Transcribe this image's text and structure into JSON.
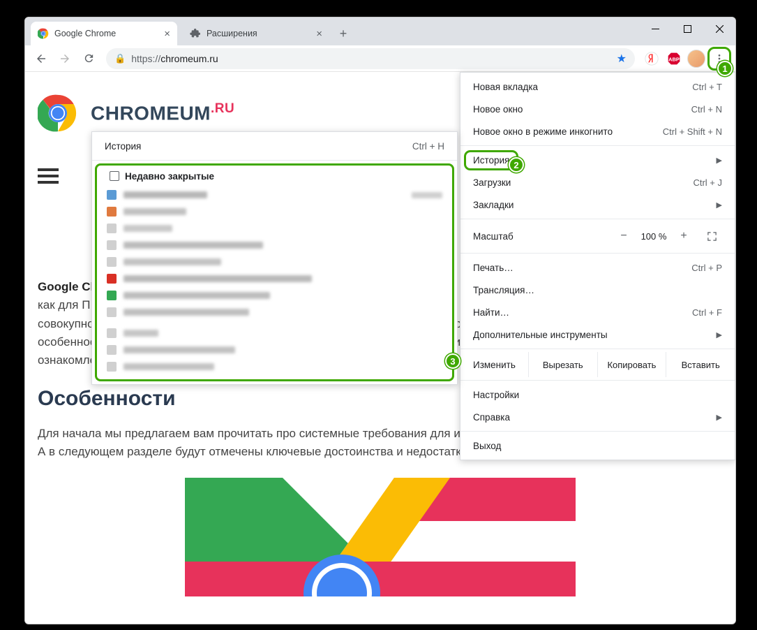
{
  "window": {
    "tabs": [
      {
        "title": "Google Chrome",
        "active": true
      },
      {
        "title": "Расширения",
        "active": false
      }
    ]
  },
  "toolbar": {
    "url_scheme": "https://",
    "url_host": "chromeum.ru"
  },
  "menu": {
    "new_tab": {
      "label": "Новая вкладка",
      "shortcut": "Ctrl + T"
    },
    "new_window": {
      "label": "Новое окно",
      "shortcut": "Ctrl + N"
    },
    "incognito": {
      "label": "Новое окно в режиме инкогнито",
      "shortcut": "Ctrl + Shift + N"
    },
    "history": {
      "label": "История"
    },
    "downloads": {
      "label": "Загрузки",
      "shortcut": "Ctrl + J"
    },
    "bookmarks": {
      "label": "Закладки"
    },
    "zoom": {
      "label": "Масштаб",
      "value": "100 %"
    },
    "print": {
      "label": "Печать…",
      "shortcut": "Ctrl + P"
    },
    "cast": {
      "label": "Трансляция…"
    },
    "find": {
      "label": "Найти…",
      "shortcut": "Ctrl + F"
    },
    "more_tools": {
      "label": "Дополнительные инструменты"
    },
    "edit": {
      "label": "Изменить",
      "cut": "Вырезать",
      "copy": "Копировать",
      "paste": "Вставить"
    },
    "settings": {
      "label": "Настройки"
    },
    "help": {
      "label": "Справка"
    },
    "exit": {
      "label": "Выход"
    }
  },
  "history_submenu": {
    "top": {
      "label": "История",
      "shortcut": "Ctrl + H"
    },
    "recently_closed": "Недавно закрытые"
  },
  "page": {
    "site_name_main": "CHROMEUM",
    "site_name_suffix": ".RU",
    "para1_bold": "Google Cl",
    "para1_rest": "как для П",
    "para1_tail": "совокупностью факторов, основной из которых – поддержка компании с мировым именем. Мы рассмотрим его особенности, краткую историю возникновения, а также процедуру установки для различных устройств. Приятного ознакомления с нашим материалом.",
    "h2": "Особенности",
    "para2": "Для начала мы предлагаем вам прочитать про системные требования для интернет-обозревателя на разных платформах. А в следующем разделе будут отмечены ключевые достоинства и недостатки."
  },
  "badges": {
    "b1": "1",
    "b2": "2",
    "b3": "3"
  }
}
